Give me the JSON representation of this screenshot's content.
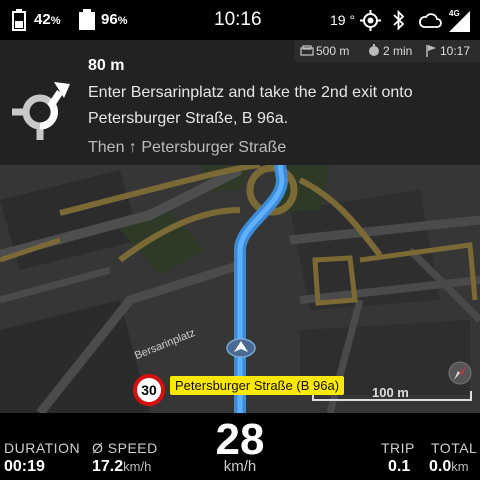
{
  "status": {
    "battery1": "42",
    "battery2": "96",
    "percent": "%",
    "clock": "10:16",
    "temperature": "19 °",
    "network": "4G"
  },
  "trip_strip": {
    "distance": "500 m",
    "duration": "2 min",
    "eta": "10:17"
  },
  "banner": {
    "distance": "80 m",
    "instruction": "Enter Bersarinplatz and take the 2nd exit onto Petersburger Straße, B 96a.",
    "then": "Then ↑ Petersburger Straße"
  },
  "map": {
    "label_bersarin": "Bersarinplatz",
    "speed_limit": "30",
    "current_street": "Petersburger Straße (B 96a)",
    "scale": "100 m"
  },
  "stats": {
    "duration_label": "DURATION",
    "duration_value": "00:19",
    "avg_speed_label": "Ø SPEED",
    "avg_speed_value": "17.2",
    "avg_speed_unit": "km/h",
    "speed_value": "28",
    "speed_unit": "km/h",
    "trip_label": "TRIP",
    "trip_value": "0.1",
    "total_label": "TOTAL",
    "total_value": "0.0",
    "total_unit": "km"
  }
}
